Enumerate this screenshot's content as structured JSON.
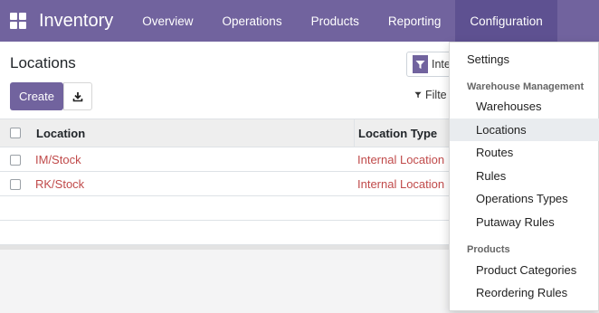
{
  "navbar": {
    "app_icon": "apps-grid-icon",
    "brand": "Inventory",
    "items": [
      {
        "label": "Overview"
      },
      {
        "label": "Operations"
      },
      {
        "label": "Products"
      },
      {
        "label": "Reporting"
      },
      {
        "label": "Configuration",
        "active": true
      }
    ]
  },
  "page": {
    "title": "Locations",
    "create_label": "Create",
    "download_icon": "download-icon"
  },
  "search": {
    "facet_icon": "filter-icon",
    "facet_label": "Inte",
    "filter_label": "Filte"
  },
  "table": {
    "columns": [
      "Location",
      "Location Type"
    ],
    "rows": [
      {
        "location": "IM/Stock",
        "type": "Internal Location"
      },
      {
        "location": "RK/Stock",
        "type": "Internal Location"
      }
    ]
  },
  "dropdown": {
    "settings": "Settings",
    "section_warehouse": "Warehouse Management",
    "warehouse_items": [
      "Warehouses",
      "Locations",
      "Routes",
      "Rules",
      "Operations Types",
      "Putaway Rules"
    ],
    "active_item": "Locations",
    "section_products": "Products",
    "product_items": [
      "Product Categories",
      "Reordering Rules"
    ]
  },
  "colors": {
    "brand": "#71639e",
    "link_red": "#c04a4a"
  }
}
